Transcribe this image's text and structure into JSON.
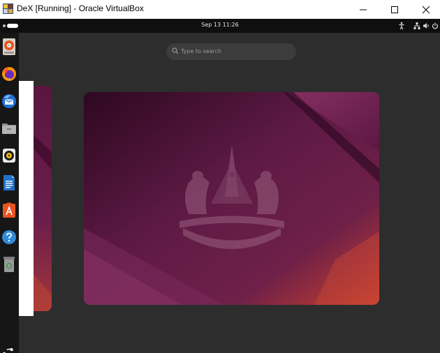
{
  "window": {
    "title": "DeX [Running] - Oracle VirtualBox",
    "app_icon": "virtualbox-icon",
    "controls": [
      "minimize-icon",
      "maximize-icon",
      "close-icon"
    ]
  },
  "topbar": {
    "clock": "Sep 13  11:26",
    "tray_icons": [
      "accessibility-icon",
      "network-icon",
      "volume-icon",
      "power-icon"
    ]
  },
  "search": {
    "placeholder": "Type to search",
    "icon": "search-icon"
  },
  "dock": {
    "apps": [
      "disk-usage-icon",
      "firefox-icon",
      "thunderbird-icon",
      "files-icon",
      "rhythmbox-icon",
      "writer-icon",
      "app-center-icon",
      "help-icon",
      "trash-icon"
    ],
    "show_apps_icon": "ubuntu-logo-icon"
  },
  "workspace": {
    "wallpaper": "ubuntu-noble-numbat-wallpaper",
    "colors": {
      "dark": "#3d0a2c",
      "mid": "#6e1f50",
      "accent": "#c8402e"
    }
  }
}
